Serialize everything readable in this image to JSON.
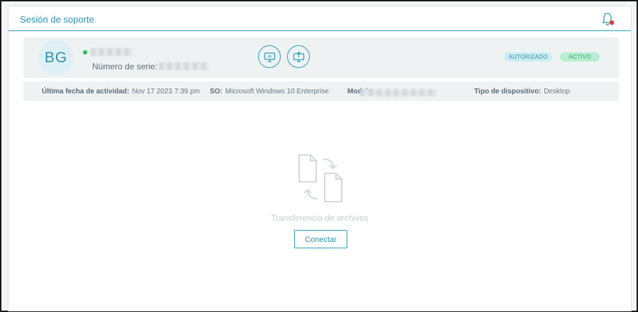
{
  "header": {
    "title": "Sesión de soporte",
    "notification_icon": "bell-icon",
    "notification_dot_color": "#e53935"
  },
  "device": {
    "initials": "BG",
    "online_status_color": "#1fbf58",
    "serial_label": "Número de serie:",
    "actions": [
      {
        "icon": "remote-desktop-icon"
      },
      {
        "icon": "file-transfer-icon"
      }
    ],
    "badges": {
      "authorized": "AUTORIZADO",
      "active": "ACTIVO"
    }
  },
  "info": {
    "last_activity_label": "Última fecha de actividad:",
    "last_activity_value": "Nov 17 2023 7:39 pm",
    "os_label": "SO:",
    "os_value": "Microsoft Windows 10 Enterprise",
    "model_label": "Modelo:",
    "device_type_label": "Tipo de dispositivo:",
    "device_type_value": "Desktop"
  },
  "file_transfer": {
    "label": "Transferencia de archivos",
    "connect_button": "Conectar"
  },
  "colors": {
    "accent": "#2a92b0",
    "authorized_badge_bg": "#c9ecf5",
    "active_badge_bg": "#b7edd0"
  }
}
